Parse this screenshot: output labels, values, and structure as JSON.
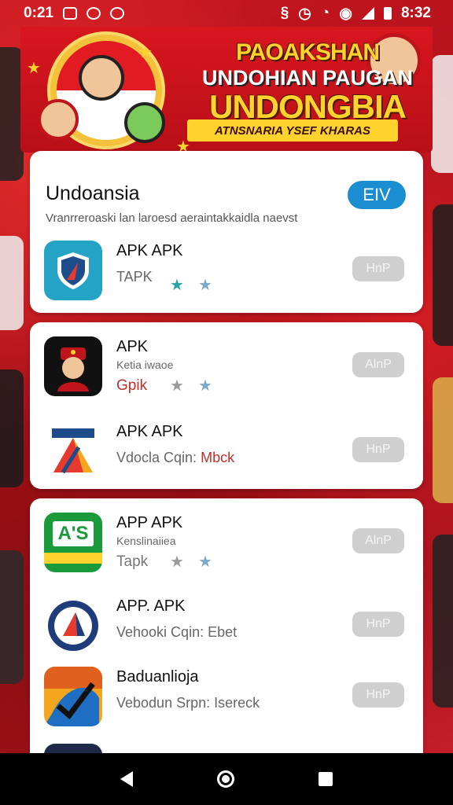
{
  "status_bar": {
    "time_left": "0:21",
    "time_right": "8:32"
  },
  "banner": {
    "line1": "PAOAKSHAN",
    "line2": "UNDOHIAN PAUGAN",
    "line3": "UNDONGBIA",
    "ribbon": "ATNSNARIA YSEF KHARAS"
  },
  "header": {
    "title": "Undoansia",
    "subtitle": "Vranrreroaski lan laroesd aeraintakkaidla naevst",
    "action_label": "EIV"
  },
  "apps": [
    {
      "name": "APK APK",
      "sub": "TAPK",
      "button": "HnP",
      "icon": "shield-icon"
    },
    {
      "name": "APK",
      "sub_small": "Ketia iwaoe",
      "sub": "Gpik",
      "button": "AlnP",
      "icon": "mascot-avatar-icon"
    },
    {
      "name": "APK APK",
      "sub": "Vdocla Cqin:",
      "sub_red": "Mbck",
      "button": "HnP",
      "icon": "triangle-logo-icon"
    },
    {
      "name": "APP APK",
      "sub_small": "Kenslinaiiea",
      "sub": "Tapk",
      "button": "AlnP",
      "icon": "ars-logo-icon",
      "icon_text": "A'S"
    },
    {
      "name": "APP. APK",
      "sub": "Vehooki Cqin: Ebet",
      "button": "HnP",
      "icon": "round-emblem-icon"
    },
    {
      "name": "Baduanlioja",
      "sub": "Vebodun Srpn: Isereck",
      "button": "HnP",
      "icon": "swoosh-logo-icon"
    }
  ],
  "colors": {
    "accent": "#1a8ed1",
    "banner_red": "#d8161e",
    "banner_gold": "#ffd22e"
  }
}
